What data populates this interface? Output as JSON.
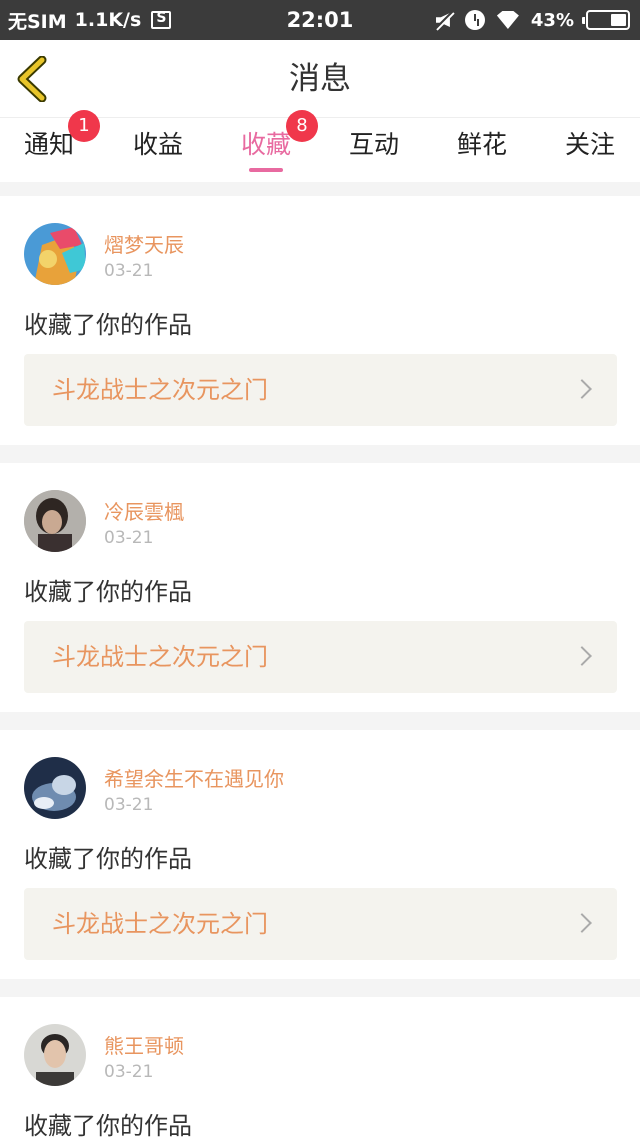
{
  "status_bar": {
    "carrier": "无SIM",
    "speed": "1.1K/s",
    "time": "22:01",
    "battery_percent": "43%",
    "battery_level": 0.43,
    "icons": [
      "screenshot-icon",
      "mute-icon",
      "alarm-icon",
      "wifi-icon",
      "battery-icon"
    ]
  },
  "header": {
    "title": "消息",
    "back_icon": "chevron-left-icon",
    "back_color": "#e8c52a"
  },
  "tabs": [
    {
      "label": "通知",
      "badge": "1"
    },
    {
      "label": "收益",
      "badge": ""
    },
    {
      "label": "收藏",
      "badge": "8",
      "active": true
    },
    {
      "label": "互动",
      "badge": ""
    },
    {
      "label": "鲜花",
      "badge": ""
    },
    {
      "label": "关注",
      "badge": ""
    }
  ],
  "colors": {
    "accent": "#e86aa0",
    "badge": "#f0374b",
    "username": "#e8955f",
    "work_title": "#e8955f",
    "work_bg": "#f4f3ee"
  },
  "feed": [
    {
      "username": "熠梦天辰",
      "date": "03-21",
      "action": "收藏了你的作品",
      "work": "斗龙战士之次元之门"
    },
    {
      "username": "冷辰雲楓",
      "date": "03-21",
      "action": "收藏了你的作品",
      "work": "斗龙战士之次元之门"
    },
    {
      "username": "希望余生不在遇见你",
      "date": "03-21",
      "action": "收藏了你的作品",
      "work": "斗龙战士之次元之门"
    },
    {
      "username": "熊王哥顿",
      "date": "03-21",
      "action": "收藏了你的作品",
      "work": ""
    }
  ]
}
